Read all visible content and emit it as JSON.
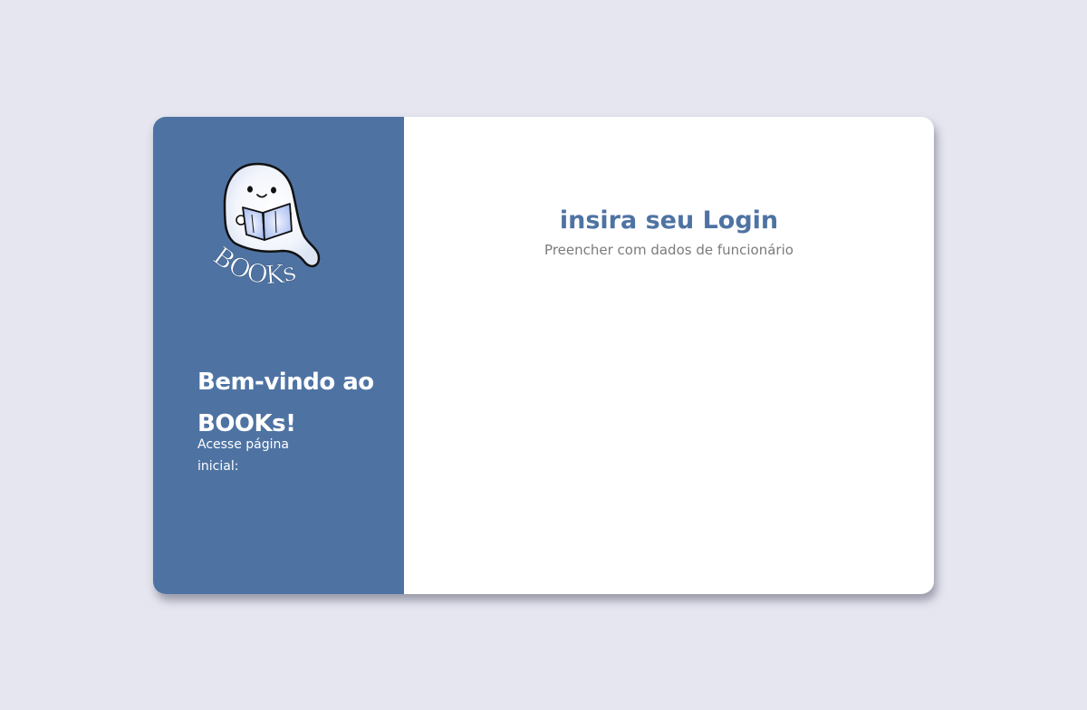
{
  "brand": {
    "logo_icon": "ghost-reading-book-icon",
    "logo_text": "BOOKs",
    "accent_color": "#4e73a3"
  },
  "welcome": {
    "title": "Bem-vindo ao BOOKs!",
    "subtitle": "Acesse página inicial:"
  },
  "login": {
    "title": "insira seu Login",
    "subtitle": "Preencher com dados de funcionário"
  }
}
